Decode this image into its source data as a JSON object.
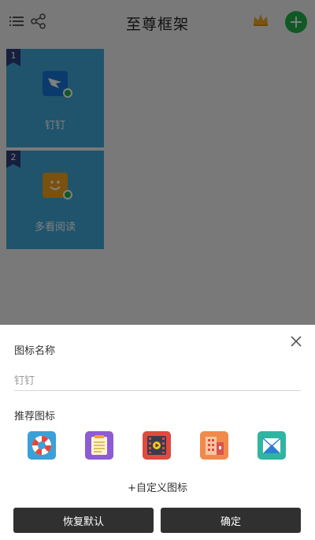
{
  "header": {
    "title": "至尊框架",
    "menu_icon": "list-icon",
    "share_icon": "share-icon",
    "crown_icon": "crown-icon",
    "add_icon": "plus-icon"
  },
  "tiles": [
    {
      "index": "1",
      "label": "钉钉",
      "icon": "dingtalk-icon"
    },
    {
      "index": "2",
      "label": "多看阅读",
      "icon": "duokan-reader-icon"
    }
  ],
  "sheet": {
    "name_label": "图标名称",
    "name_value": "钉钉",
    "recommend_label": "推荐图标",
    "recommended_icons": [
      {
        "name": "lifebuoy-icon",
        "color": "#3aa0d8"
      },
      {
        "name": "notepad-icon",
        "color": "#8e5bd6"
      },
      {
        "name": "film-icon",
        "color": "#e04a3f"
      },
      {
        "name": "building-icon",
        "color": "#f08a4b"
      },
      {
        "name": "mail-icon",
        "color": "#2fb5a0"
      }
    ],
    "custom_link": "+自定义图标",
    "restore_button": "恢复默认",
    "confirm_button": "确定"
  },
  "colors": {
    "accent_green": "#21b14a",
    "tile_blue": "#3fa9d8",
    "button_dark": "#303030"
  }
}
